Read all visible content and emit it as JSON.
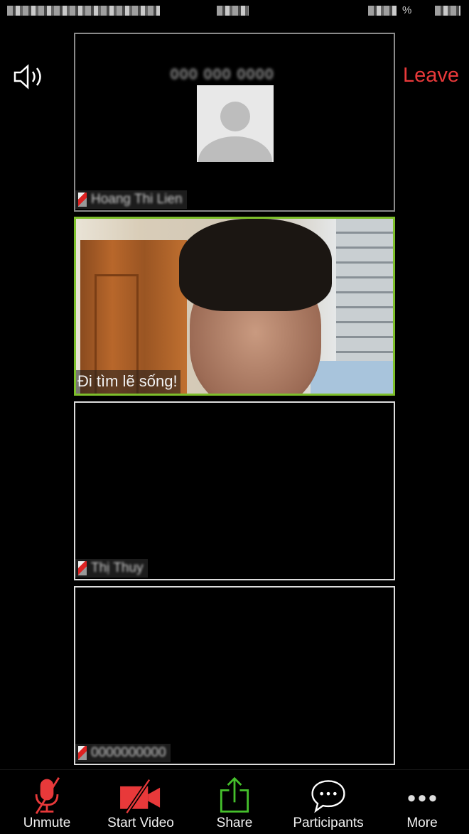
{
  "status_bar": {
    "battery_percent_label": "%"
  },
  "top_bar": {
    "meeting_title": "000 000 0000",
    "leave_label": "Leave"
  },
  "tiles": [
    {
      "name": "Hoang Thi Lien",
      "state": "video-off-avatar",
      "muted": true
    },
    {
      "caption": "Đi tìm lẽ sống!",
      "state": "video-on",
      "active_speaker": true,
      "highlight_color": "#7dbf2b"
    },
    {
      "name": "Thị Thuy",
      "state": "video-off",
      "muted": true
    },
    {
      "name": "0000000000",
      "state": "video-off",
      "muted": true
    }
  ],
  "toolbar": {
    "buttons": [
      {
        "label": "Unmute",
        "icon": "microphone-off-icon",
        "color": "#e8393a"
      },
      {
        "label": "Start Video",
        "icon": "video-camera-off-icon",
        "color": "#e8393a"
      },
      {
        "label": "Share",
        "icon": "share-upload-icon",
        "color": "#45c02c"
      },
      {
        "label": "Participants",
        "icon": "chat-bubble-icon",
        "color": "#ffffff"
      },
      {
        "label": "More",
        "icon": "more-dots-icon",
        "color": "#ffffff"
      }
    ]
  }
}
